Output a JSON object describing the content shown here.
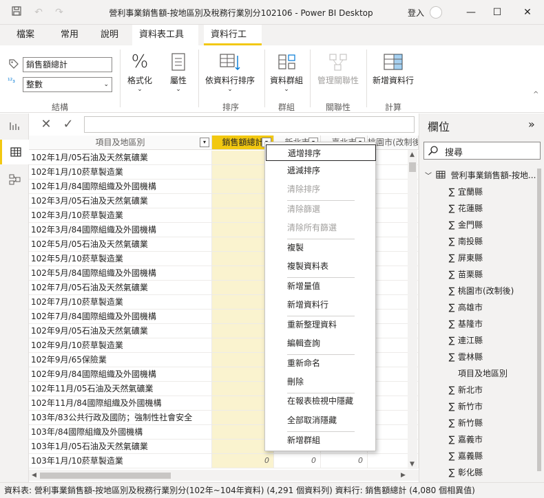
{
  "window": {
    "title": "營利事業銷售額-按地區別及稅務行業別分102106 - Power BI Desktop",
    "signin": "登入"
  },
  "menu": {
    "tabs": [
      "檔案",
      "常用",
      "說明",
      "資料表工具",
      "資料行工具"
    ]
  },
  "ribbon": {
    "name_value": "銷售額總計",
    "datatype_value": "整數",
    "format_label": "格式化",
    "properties_label": "屬性",
    "sort_by_column_label": "依資料行排序",
    "data_groups_label": "資料群組",
    "manage_relationships_label": "管理關聯性",
    "new_column_label": "新增資料行",
    "group_labels": [
      "結構",
      "排序",
      "群組",
      "關聯性",
      "計算"
    ]
  },
  "grid": {
    "columns": [
      "項目及地區別",
      "銷售額總計",
      "新北市",
      "臺北市",
      "桃園市(改制後)"
    ],
    "rows": [
      "102年1月/05石油及天然氣礦業",
      "102年1月/10菸草製造業",
      "102年1月/84國際組織及外國機構",
      "102年3月/05石油及天然氣礦業",
      "102年3月/10菸草製造業",
      "102年3月/84國際組織及外國機構",
      "102年5月/05石油及天然氣礦業",
      "102年5月/10菸草製造業",
      "102年5月/84國際組織及外國機構",
      "102年7月/05石油及天然氣礦業",
      "102年7月/10菸草製造業",
      "102年7月/84國際組織及外國機構",
      "102年9月/05石油及天然氣礦業",
      "102年9月/10菸草製造業",
      "102年9月/65保險業",
      "102年9月/84國際組織及外國機構",
      "102年11月/05石油及天然氣礦業",
      "102年11月/84國際組織及外國機構",
      "103年/83公共行政及國防；強制性社會安全",
      "103年/84國際組織及外國機構",
      "103年1月/05石油及天然氣礦業",
      "103年1月/10菸草製造業"
    ],
    "last_row_values": [
      "0",
      "0",
      "0"
    ]
  },
  "context_menu": {
    "items": [
      {
        "label": "遞增排序",
        "disabled": false
      },
      {
        "label": "遞減排序",
        "disabled": false
      },
      {
        "label": "清除排序",
        "disabled": true
      },
      {
        "label": "清除篩選",
        "disabled": true
      },
      {
        "label": "清除所有篩選",
        "disabled": true
      },
      {
        "label": "複製",
        "disabled": false
      },
      {
        "label": "複製資料表",
        "disabled": false
      },
      {
        "label": "新增量值",
        "disabled": false
      },
      {
        "label": "新增資料行",
        "disabled": false
      },
      {
        "label": "重新整理資料",
        "disabled": false
      },
      {
        "label": "編輯查詢",
        "disabled": false
      },
      {
        "label": "重新命名",
        "disabled": false
      },
      {
        "label": "刪除",
        "disabled": false
      },
      {
        "label": "在報表檢視中隱藏",
        "disabled": false
      },
      {
        "label": "全部取消隱藏",
        "disabled": false
      },
      {
        "label": "新增群組",
        "disabled": false
      }
    ]
  },
  "fields_pane": {
    "title": "欄位",
    "search_placeholder": "搜尋",
    "table_name": "營利事業銷售額-按地...",
    "fields": [
      {
        "label": "宜蘭縣",
        "sigma": true
      },
      {
        "label": "花蓮縣",
        "sigma": true
      },
      {
        "label": "金門縣",
        "sigma": true
      },
      {
        "label": "南投縣",
        "sigma": true
      },
      {
        "label": "屏東縣",
        "sigma": true
      },
      {
        "label": "苗栗縣",
        "sigma": true
      },
      {
        "label": "桃園市(改制後)",
        "sigma": true
      },
      {
        "label": "高雄市",
        "sigma": true
      },
      {
        "label": "基隆市",
        "sigma": true
      },
      {
        "label": "連江縣",
        "sigma": true
      },
      {
        "label": "雲林縣",
        "sigma": true
      },
      {
        "label": "項目及地區別",
        "sigma": false
      },
      {
        "label": "新北市",
        "sigma": true
      },
      {
        "label": "新竹市",
        "sigma": true
      },
      {
        "label": "新竹縣",
        "sigma": true
      },
      {
        "label": "嘉義市",
        "sigma": true
      },
      {
        "label": "嘉義縣",
        "sigma": true
      },
      {
        "label": "彰化縣",
        "sigma": true
      }
    ]
  },
  "status": {
    "text": "資料表: 營利事業銷售額-按地區別及稅務行業別分(102年~104年資料) (4,291 個資料列) 資料行: 銷售額總計 (4,080 個相異值)"
  },
  "colors": {
    "accent": "#f2c811",
    "selected_column_fill": "#faf3cf",
    "disabled_text": "#a19f9d"
  }
}
